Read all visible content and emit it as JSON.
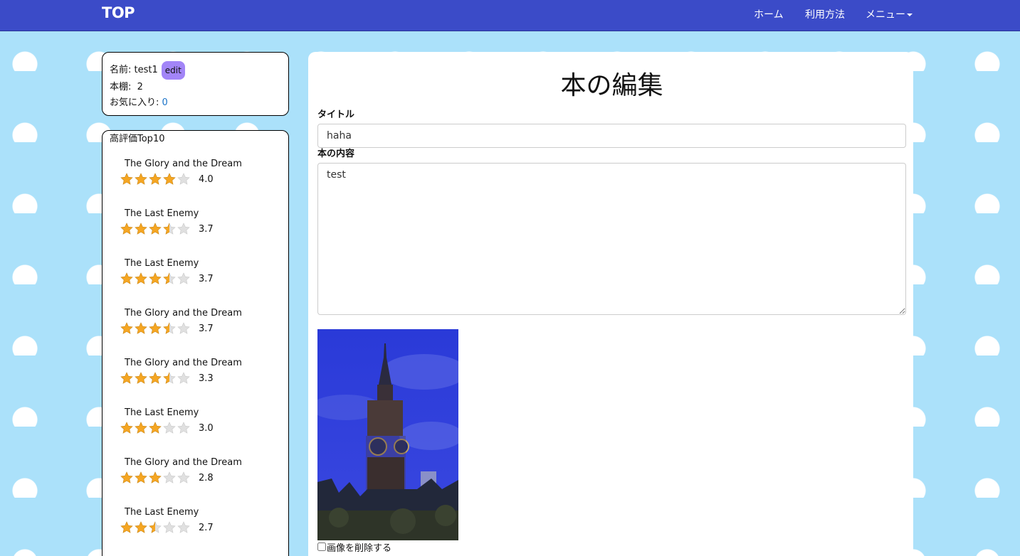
{
  "navbar": {
    "brand": "TOP",
    "home": "ホーム",
    "usage": "利用方法",
    "menu": "メニュー"
  },
  "profile": {
    "name_label": "名前: test1",
    "edit_label": "edit",
    "shelf_label": "本棚:  2",
    "favorites_label": "お気に入り: ",
    "favorites_count": "0"
  },
  "top10": {
    "title": "高評価Top10",
    "books": [
      {
        "title": "The Glory and the Dream",
        "rating": 4.0,
        "rating_text": "4.0"
      },
      {
        "title": "The Last Enemy",
        "rating": 3.7,
        "rating_text": "3.7"
      },
      {
        "title": "The Last Enemy",
        "rating": 3.7,
        "rating_text": "3.7"
      },
      {
        "title": "The Glory and the Dream",
        "rating": 3.7,
        "rating_text": "3.7"
      },
      {
        "title": "The Glory and the Dream",
        "rating": 3.3,
        "rating_text": "3.3"
      },
      {
        "title": "The Last Enemy",
        "rating": 3.0,
        "rating_text": "3.0"
      },
      {
        "title": "The Glory and the Dream",
        "rating": 2.8,
        "rating_text": "2.8"
      },
      {
        "title": "The Last Enemy",
        "rating": 2.7,
        "rating_text": "2.7"
      }
    ]
  },
  "form": {
    "heading": "本の編集",
    "title_label": "タイトル",
    "title_value": "haha",
    "content_label": "本の内容",
    "content_value": "test",
    "delete_image_label": "画像を削除する"
  },
  "colors": {
    "navbar": "#3b4bc8",
    "background": "#abe1fa",
    "edit_button": "#a285f7",
    "star_filled": "#f5a623",
    "star_empty": "#e0e0e0"
  }
}
